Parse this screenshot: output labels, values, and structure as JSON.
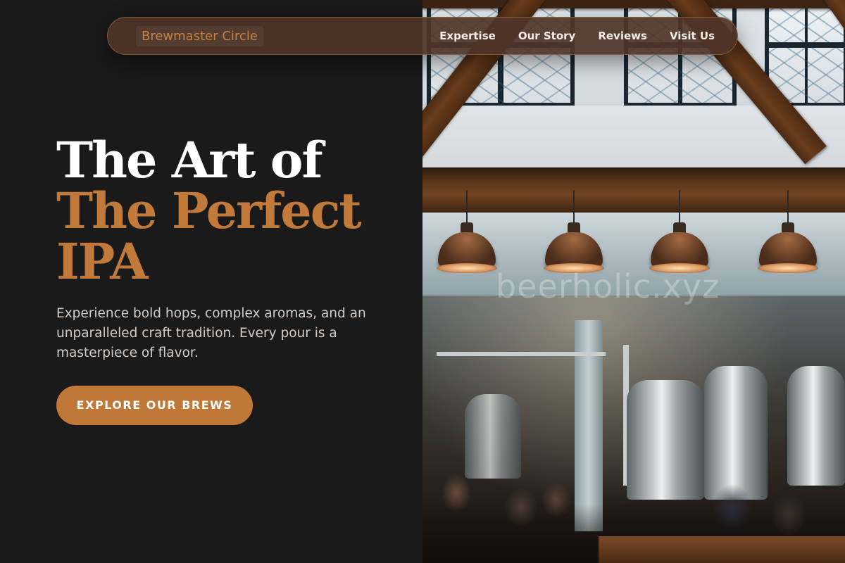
{
  "header": {
    "brand": "Brewmaster Circle",
    "nav": [
      "Expertise",
      "Our Story",
      "Reviews",
      "Visit Us"
    ]
  },
  "hero": {
    "headline_line1": "The Art of",
    "headline_line2": "The Perfect",
    "headline_line3": "IPA",
    "description": "Experience bold hops, complex aromas, and an unparalleled craft tradition. Every pour is a masterpiece of flavor.",
    "cta_label": "EXPLORE OUR BREWS"
  },
  "image": {
    "watermark": "beerholic.xyz"
  },
  "colors": {
    "background": "#1b1a1a",
    "accent": "#c17a3a",
    "nav_bg": "#4e3428",
    "heading_white": "#ffffff"
  }
}
